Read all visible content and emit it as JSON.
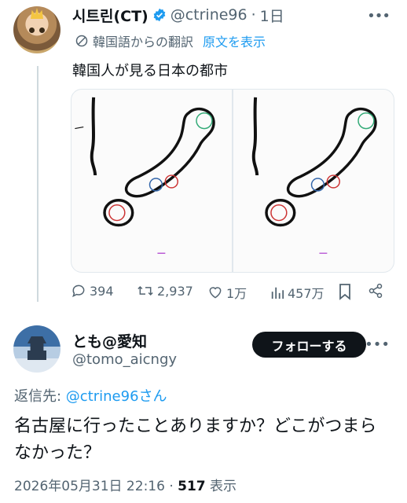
{
  "tweet": {
    "author_name": "시트린(CT)",
    "handle": "@ctrine96",
    "time": "1日",
    "translated_label": "韓国語からの翻訳",
    "show_original": "原文を表示",
    "text": "韓国人が見る日本の都市",
    "stats": {
      "replies": "394",
      "retweets": "2,937",
      "likes": "1万",
      "views": "457万"
    }
  },
  "reply": {
    "author_name": "とも@愛知",
    "handle": "@tomo_aicngy",
    "follow_label": "フォローする",
    "reply_to_label": "返信先: ",
    "reply_to_handle": "@ctrine96さん",
    "text": "名古屋に行ったことありますか？どこがつまらなかった？",
    "timestamp": "2026年05月31日 22:16 · ",
    "views_count": "517",
    "views_label": " 表示"
  },
  "colors": {
    "link": "#1d9bf0",
    "muted": "#536471",
    "text": "#0f1419"
  }
}
